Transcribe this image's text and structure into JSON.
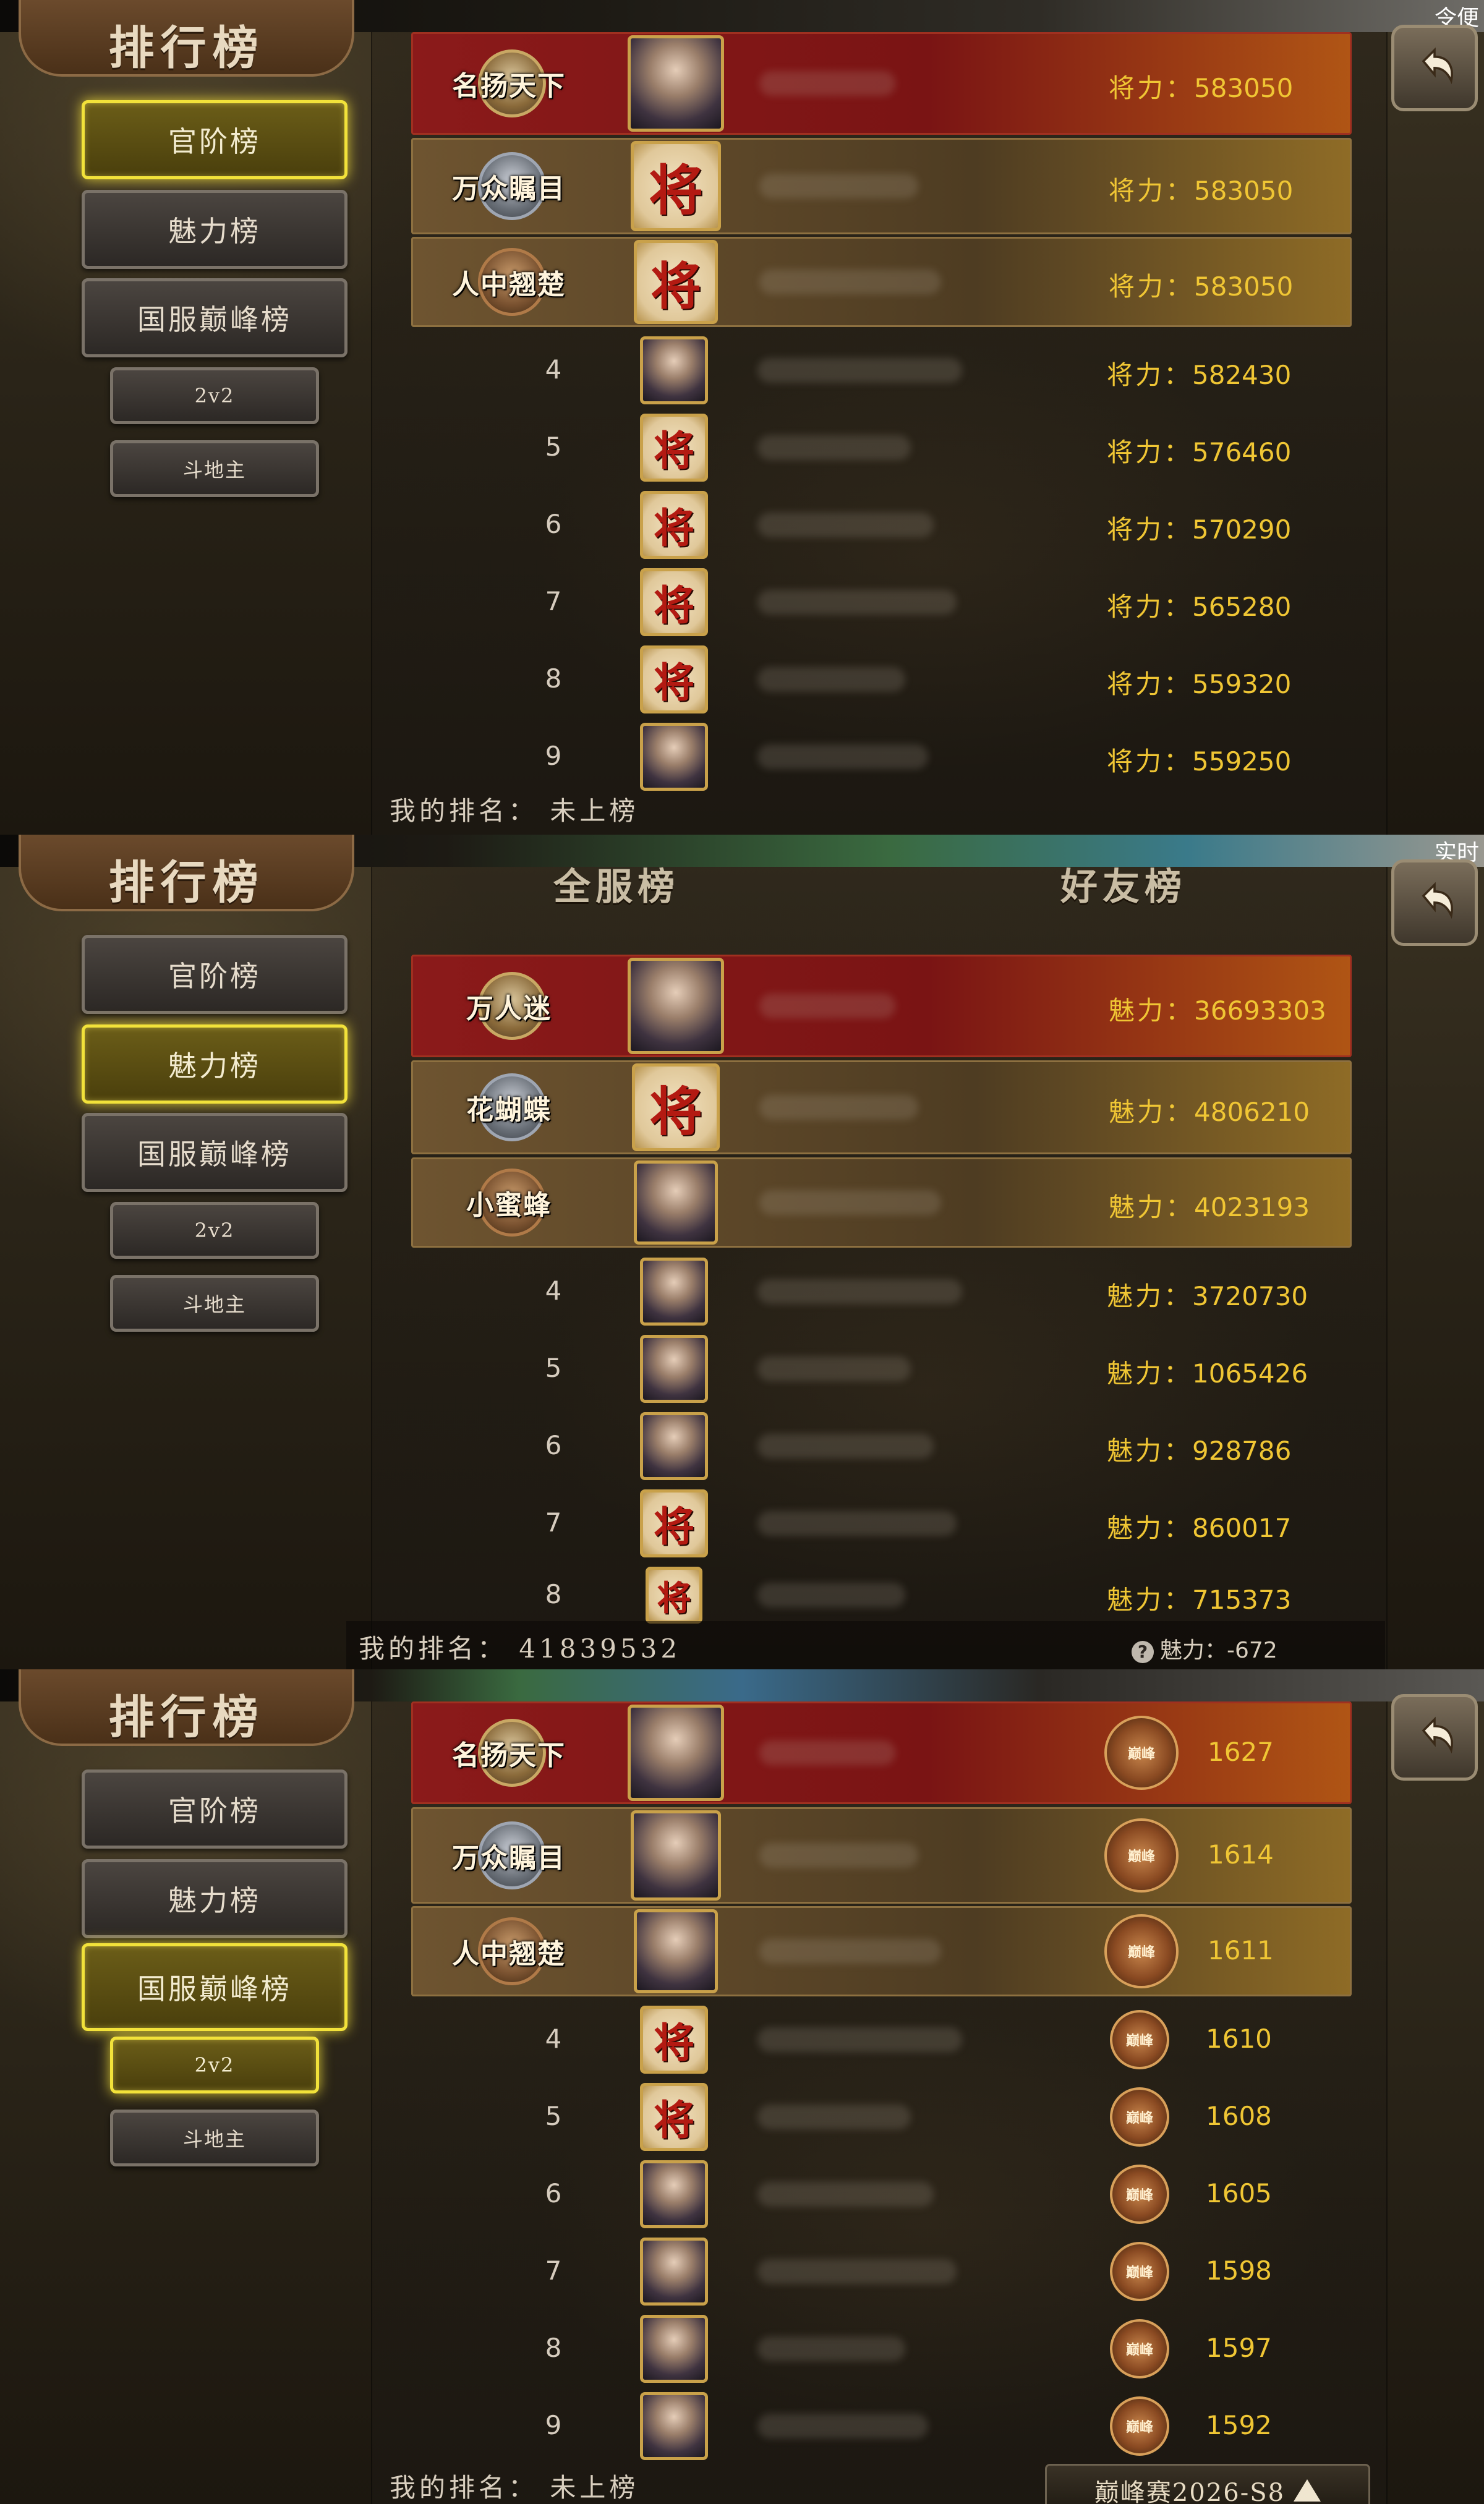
{
  "sidebar": {
    "title": "排行榜",
    "btn_official": "官阶榜",
    "btn_charm": "魅力榜",
    "btn_peak": "国服巅峰榜",
    "btn_2v2": "2v2",
    "btn_landlord": "斗地主"
  },
  "corner_text_1": "令便",
  "corner_text_2": "实时",
  "panel1": {
    "score_label": "将力：",
    "my_rank": "我的排名：  未上榜",
    "rows": [
      {
        "rank": "1",
        "title": "名扬天下",
        "avatar": "hero",
        "value": "583050"
      },
      {
        "rank": "2",
        "title": "万众瞩目",
        "avatar": "jiang",
        "value": "583050"
      },
      {
        "rank": "3",
        "title": "人中翘楚",
        "avatar": "jiang",
        "value": "583050"
      },
      {
        "rank": "4",
        "title": "",
        "avatar": "hero",
        "value": "582430"
      },
      {
        "rank": "5",
        "title": "",
        "avatar": "jiang",
        "value": "576460"
      },
      {
        "rank": "6",
        "title": "",
        "avatar": "jiang",
        "value": "570290"
      },
      {
        "rank": "7",
        "title": "",
        "avatar": "jiang",
        "value": "565280"
      },
      {
        "rank": "8",
        "title": "",
        "avatar": "jiang",
        "value": "559320"
      },
      {
        "rank": "9",
        "title": "",
        "avatar": "hero",
        "value": "559250"
      }
    ]
  },
  "panel2": {
    "tab_server": "全服榜",
    "tab_friends": "好友榜",
    "score_label": "魅力：",
    "my_rank": "我的排名：  41839532",
    "my_charm_label": "魅力：",
    "my_charm_value": "-672",
    "rows": [
      {
        "rank": "1",
        "title": "万人迷",
        "avatar": "hero",
        "value": "36693303"
      },
      {
        "rank": "2",
        "title": "花蝴蝶",
        "avatar": "jiang",
        "value": "4806210"
      },
      {
        "rank": "3",
        "title": "小蜜蜂",
        "avatar": "hero",
        "value": "4023193"
      },
      {
        "rank": "4",
        "title": "",
        "avatar": "hero",
        "value": "3720730"
      },
      {
        "rank": "5",
        "title": "",
        "avatar": "hero",
        "value": "1065426"
      },
      {
        "rank": "6",
        "title": "",
        "avatar": "hero",
        "value": "928786"
      },
      {
        "rank": "7",
        "title": "",
        "avatar": "jiang",
        "value": "860017"
      },
      {
        "rank": "8",
        "title": "",
        "avatar": "jiang",
        "value": "715373"
      }
    ]
  },
  "panel3": {
    "peak_icon_text": "巅峰",
    "my_rank": "我的排名：  未上榜",
    "season_label": "巅峰赛2026-S8",
    "rows": [
      {
        "rank": "1",
        "title": "名扬天下",
        "avatar": "hero",
        "value": "1627"
      },
      {
        "rank": "2",
        "title": "万众瞩目",
        "avatar": "hero",
        "value": "1614"
      },
      {
        "rank": "3",
        "title": "人中翘楚",
        "avatar": "hero",
        "value": "1611"
      },
      {
        "rank": "4",
        "title": "",
        "avatar": "jiang",
        "value": "1610"
      },
      {
        "rank": "5",
        "title": "",
        "avatar": "jiang",
        "value": "1608"
      },
      {
        "rank": "6",
        "title": "",
        "avatar": "hero",
        "value": "1605"
      },
      {
        "rank": "7",
        "title": "",
        "avatar": "hero",
        "value": "1598"
      },
      {
        "rank": "8",
        "title": "",
        "avatar": "hero",
        "value": "1597"
      },
      {
        "rank": "9",
        "title": "",
        "avatar": "hero",
        "value": "1592"
      }
    ]
  },
  "colors": {
    "accent_yellow": "#f2e23a",
    "score_gold": "#f0c634",
    "first_row_red": "#8b1a1a"
  }
}
